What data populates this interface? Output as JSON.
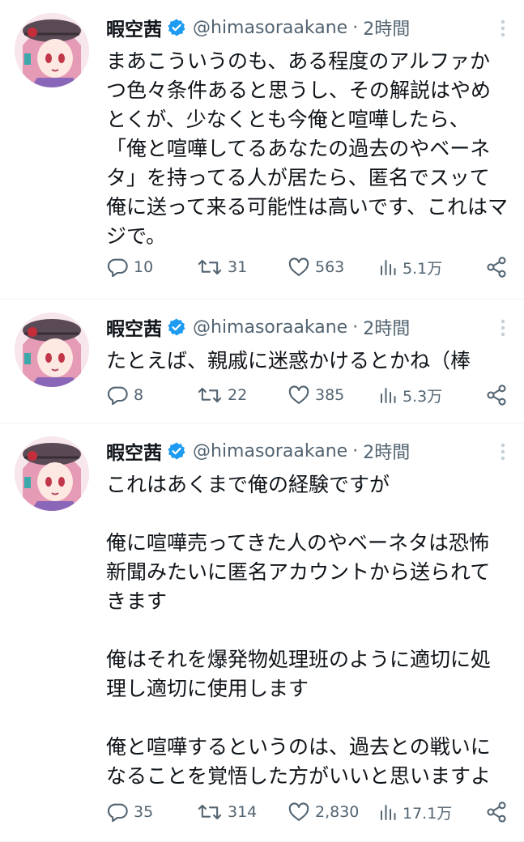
{
  "tweets": [
    {
      "name": "暇空茜",
      "handle": "@himasoraakane",
      "dot": "·",
      "time": "2時間",
      "text": "まあこういうのも、ある程度のアルファかつ色々条件あると思うし、その解説はやめとくが、少なくとも今俺と喧嘩したら、\n「俺と喧嘩してるあなたの過去のやベーネタ」を持ってる人が居たら、匿名でスッて俺に送って来る可能性は高いです、これはマジで。",
      "replies": "10",
      "retweets": "31",
      "likes": "563",
      "views": "5.1万"
    },
    {
      "name": "暇空茜",
      "handle": "@himasoraakane",
      "dot": "·",
      "time": "2時間",
      "text": "たとえば、親戚に迷惑かけるとかね（棒",
      "replies": "8",
      "retweets": "22",
      "likes": "385",
      "views": "5.3万"
    },
    {
      "name": "暇空茜",
      "handle": "@himasoraakane",
      "dot": "·",
      "time": "2時間",
      "text": "これはあくまで俺の経験ですが\n\n俺に喧嘩売ってきた人のやベーネタは恐怖新聞みたいに匿名アカウントから送られてきます\n\n俺はそれを爆発物処理班のように適切に処理し適切に使用します\n\n俺と喧嘩するというのは、過去との戦いになることを覚悟した方がいいと思いますよ",
      "replies": "35",
      "retweets": "314",
      "likes": "2,830",
      "views": "17.1万"
    }
  ],
  "icons": {
    "verified": "verified-badge-icon",
    "more": "more-vertical-icon",
    "reply": "reply-icon",
    "retweet": "retweet-icon",
    "like": "heart-icon",
    "views": "views-chart-icon",
    "share": "share-icon"
  },
  "colors": {
    "text": "#0f1419",
    "secondary": "#536471",
    "verified": "#1d9bf0",
    "divider": "#eff3f4"
  }
}
